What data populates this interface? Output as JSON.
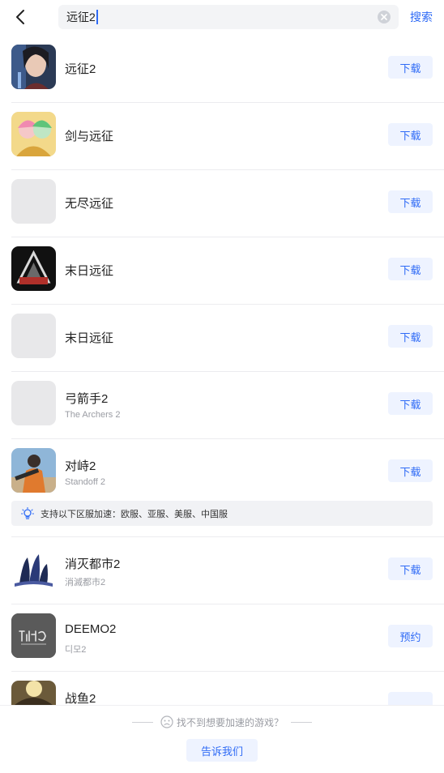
{
  "search": {
    "query": "远征2",
    "search_label": "搜索"
  },
  "results": [
    {
      "name": "远征2",
      "sub": "",
      "action": "下载",
      "icon": "game-icon-expedition2"
    },
    {
      "name": "剑与远征",
      "sub": "",
      "action": "下载",
      "icon": "game-icon-afk-arena"
    },
    {
      "name": "无尽远征",
      "sub": "",
      "action": "下载",
      "icon": "placeholder-icon"
    },
    {
      "name": "末日远征",
      "sub": "",
      "action": "下载",
      "icon": "game-icon-amg"
    },
    {
      "name": "末日远征",
      "sub": "",
      "action": "下载",
      "icon": "placeholder-icon"
    },
    {
      "name": "弓箭手2",
      "sub": "The Archers 2",
      "action": "下载",
      "icon": "placeholder-icon"
    },
    {
      "name": "对峙2",
      "sub": "Standoff 2",
      "action": "下载",
      "icon": "game-icon-standoff2"
    },
    {
      "name": "消灭都市2",
      "sub": "消滅都市2",
      "action": "下载",
      "icon": "game-icon-shoumetsu"
    },
    {
      "name": "DEEMO2",
      "sub": "디모2",
      "action": "预约",
      "icon": "game-icon-deemo2"
    },
    {
      "name": "战鱼2",
      "sub": "",
      "action": "",
      "icon": "game-icon-warfish"
    }
  ],
  "notice": {
    "text": "支持以下区服加速：欧服、亚服、美服、中国服",
    "icon": "lightbulb-icon"
  },
  "footer": {
    "hint": "找不到想要加速的游戏？",
    "tell_us": "告诉我们"
  },
  "colors": {
    "accent": "#2f6bf6",
    "button_bg": "#eef3ff",
    "notice_bg": "#f1f2f5"
  }
}
